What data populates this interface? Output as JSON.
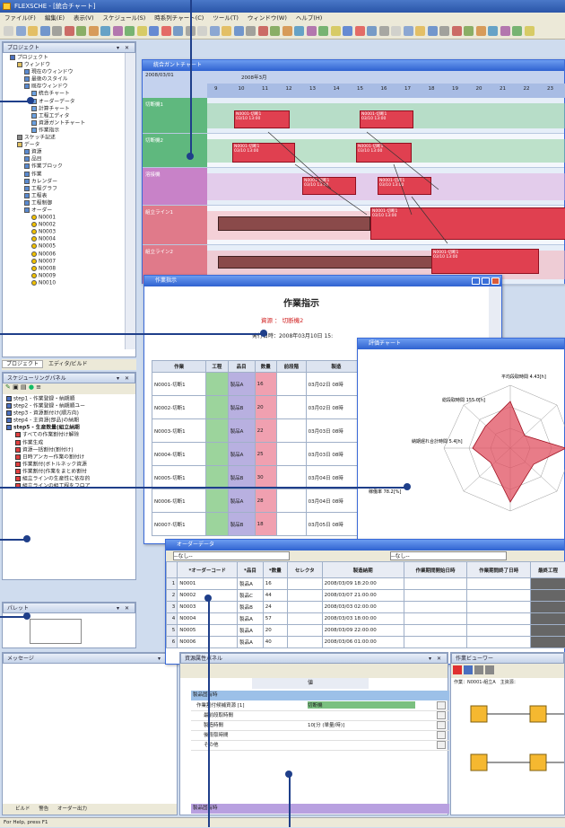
{
  "app": {
    "title": "FLEXSCHE - [統合チャート]"
  },
  "menu": [
    "ファイル(F)",
    "編集(E)",
    "表示(V)",
    "スケジュール(S)",
    "時系列チャート(C)",
    "ツール(T)",
    "ウィンドウ(W)",
    "ヘルプ(H)"
  ],
  "project_panel": {
    "title": "プロジェクト",
    "tabs": [
      "プロジェクト",
      "エディタ/ビルド"
    ],
    "tree": [
      "プロジェクト",
      "ウィンドウ",
      "現在のウィンドウ",
      "最後のスタイル",
      "既存ウィンドウ",
      "統合チャート",
      "オーダーデータ",
      "計算チャート",
      "工程エディタ",
      "資源ガントチャート",
      "作業指示",
      "スケッチ記述",
      "データ",
      "資源",
      "品目",
      "作業ブロック",
      "作業",
      "カレンダー",
      "工程グラフ",
      "工程表",
      "工程制御",
      "オーダー",
      "N0001",
      "N0002",
      "N0003",
      "N0004",
      "N0005",
      "N0006",
      "N0007",
      "N0008",
      "N0009",
      "N0010"
    ]
  },
  "schedule_panel": {
    "title": "スケジューリングパネル",
    "steps": [
      "step1 - 作業登録・納期順",
      "step2 - 作業登録・納期順ユー",
      "step3 - 資源割付け(順方向)",
      "step4 - 主資源(部品)の納期",
      "step5 - 生産数量(組立納期",
      "すべての作業割付け解除",
      "作業生成",
      "資源一括割付(割付け)",
      "日時アンカー作業の割付け",
      "作業割付(ボトルネック資源",
      "作業割付(作業をまとめ割付",
      "組立ラインの生産性に依存的",
      "組立ラインの組工程をフロア"
    ]
  },
  "palette_panel": {
    "title": "パレット"
  },
  "message_panel": {
    "title": "メッセージ",
    "tabs": [
      "ビルド",
      "警告",
      "オーダー出力"
    ]
  },
  "gantt": {
    "title": "統合ガントチャート",
    "header_date": "2008/03/01",
    "header_month": "2008年3月",
    "days": [
      "9",
      "10",
      "11",
      "12",
      "13",
      "14",
      "15",
      "16",
      "17",
      "18",
      "19",
      "20",
      "21",
      "22",
      "23"
    ],
    "rows": [
      {
        "label": "切断機1",
        "color": "#5fb87e"
      },
      {
        "label": "切断機2",
        "color": "#5fb87e"
      },
      {
        "label": "溶接機",
        "color": "#c882c8"
      },
      {
        "label": "組立ライン1",
        "color": "#e07a8a"
      },
      {
        "label": "組立ライン2",
        "color": "#e07a8a"
      }
    ],
    "task_text": "N0001-切断1\n03/10 13:00"
  },
  "work_order": {
    "title": "作業指示",
    "heading": "作業指示",
    "resource_label": "資源 ： 切断機2",
    "date_label": "発行日時：2008年03月10日 15:",
    "headers": [
      "作業",
      "工程",
      "品目",
      "数量",
      "前段階",
      "製造"
    ],
    "rows": [
      [
        "N0001-切断1",
        "",
        "製品A",
        "16",
        "",
        "03月02日 08時"
      ],
      [
        "N0002-切断1",
        "",
        "製品B",
        "20",
        "",
        "03月02日 08時"
      ],
      [
        "N0003-切断1",
        "",
        "製品A",
        "22",
        "",
        "03月03日 08時"
      ],
      [
        "N0004-切断1",
        "",
        "製品A",
        "25",
        "",
        "03月03日 08時"
      ],
      [
        "N0005-切断1",
        "",
        "製品B",
        "30",
        "",
        "03月04日 08時"
      ],
      [
        "N0006-切断1",
        "",
        "製品A",
        "28",
        "",
        "03月04日 08時"
      ],
      [
        "N0007-切断1",
        "",
        "製品B",
        "18",
        "",
        "03月05日 08時"
      ]
    ]
  },
  "radar": {
    "title": "評価チャート",
    "labels": [
      "平均段取時間\n4.43[h]",
      "総段取時間\n155.0[h]",
      "納期遅れ合計時間\n5.4[h]",
      "稼働率\n78.2[%]"
    ]
  },
  "orders": {
    "title": "オーダーデータ",
    "filter1": "--なし--",
    "filter2": "--なし--",
    "headers": [
      "",
      "*オーダーコード",
      "*品目",
      "*数量",
      "セレクタ",
      "製造納期",
      "作業期間開始日時",
      "作業期間終了日時",
      "最終工程"
    ],
    "rows": [
      [
        "1",
        "N0001",
        "製品A",
        "16",
        "",
        "2008/03/09 18:20:00",
        "",
        "",
        ""
      ],
      [
        "2",
        "N0002",
        "製品C",
        "44",
        "",
        "2008/03/07 21:00:00",
        "",
        "",
        ""
      ],
      [
        "3",
        "N0003",
        "製品B",
        "24",
        "",
        "2008/03/03 02:00:00",
        "",
        "",
        ""
      ],
      [
        "4",
        "N0004",
        "製品A",
        "57",
        "",
        "2008/03/03 18:00:00",
        "",
        "",
        ""
      ],
      [
        "5",
        "N0005",
        "製品A",
        "20",
        "",
        "2008/03/09 22:00:00",
        "",
        "",
        ""
      ],
      [
        "6",
        "N0006",
        "製品A",
        "40",
        "",
        "2008/03/06 01:00:00",
        "",
        "",
        ""
      ]
    ]
  },
  "props": {
    "title": "資源属性パネル",
    "col": "値",
    "section1": "製品固有時",
    "items": [
      "作業割付候補資源 [1]",
      "最前段取時間",
      "製造時間",
      "後段取時間",
      "その他"
    ],
    "values": [
      "切断機",
      "",
      "10[分 (単量/時)]",
      "",
      ""
    ],
    "section2": "製品固有時"
  },
  "process_viewer": {
    "title": "作業ビューワー",
    "label": "作業：N0001-組立A　主資源："
  },
  "status": "For Help, press F1",
  "colors": {
    "accent": "#2f62d0",
    "task": "#e04050",
    "callout": "#1f3f8a"
  }
}
